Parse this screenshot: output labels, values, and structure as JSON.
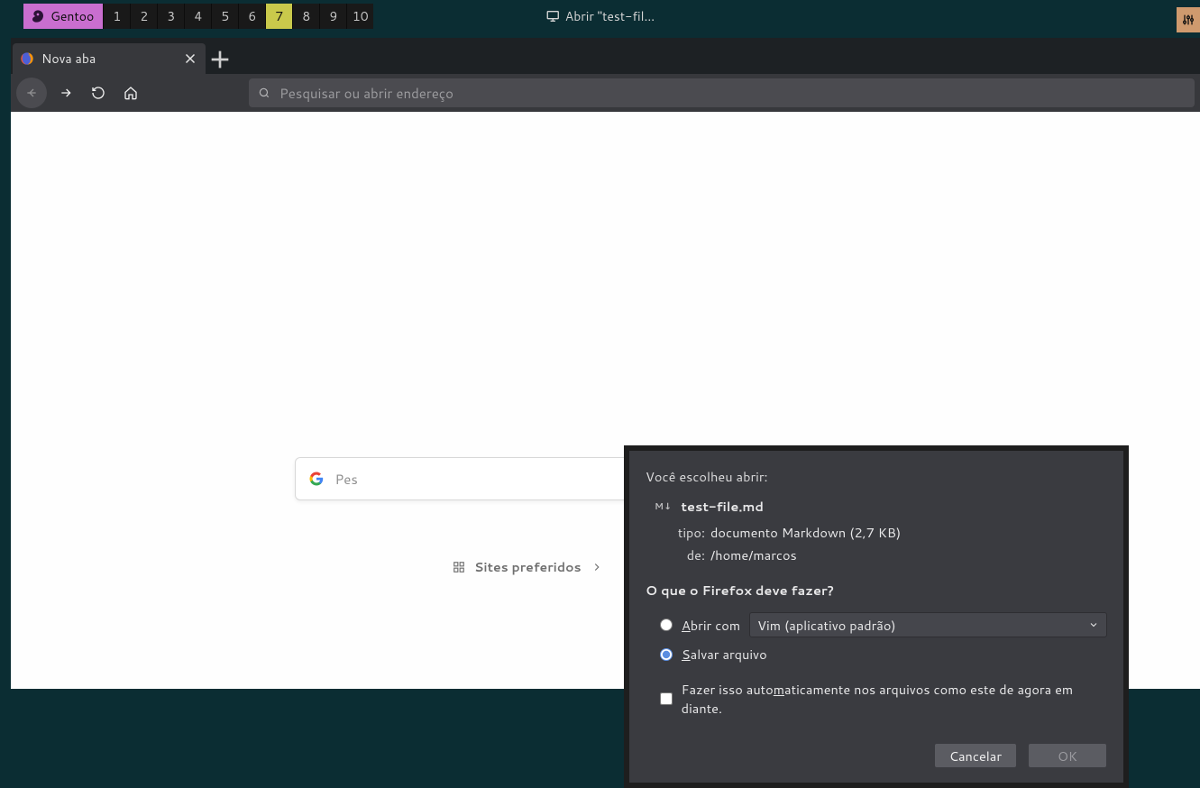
{
  "taskbar": {
    "distro": "Gentoo",
    "workspaces": [
      "1",
      "2",
      "3",
      "4",
      "5",
      "6",
      "7",
      "8",
      "9",
      "10"
    ],
    "active_workspace": 7,
    "window_title": "Abrir \"test-fil…"
  },
  "browser": {
    "tab_title": "Nova aba",
    "url_placeholder": "Pesquisar ou abrir endereço",
    "center_search_placeholder": "Pes",
    "topsites_label": "Sites preferidos"
  },
  "dialog": {
    "intro": "Você escolheu abrir:",
    "file_badge": "M↓",
    "file_name": "test-file.md",
    "type_label": "tipo:",
    "type_value": "documento Markdown (2,7 KB)",
    "from_label": "de:",
    "from_value": "/home/marcos",
    "question": "O que o Firefox deve fazer?",
    "open_with_pre": "A",
    "open_with_post": "brir com",
    "open_with_app": "Vim (aplicativo padrão)",
    "save_pre": "S",
    "save_post": "alvar arquivo",
    "auto_pre": "Fazer isso auto",
    "auto_mid": "m",
    "auto_post": "aticamente nos arquivos como este de agora em diante.",
    "selected_option": "save",
    "cancel": "Cancelar",
    "ok": "OK"
  }
}
